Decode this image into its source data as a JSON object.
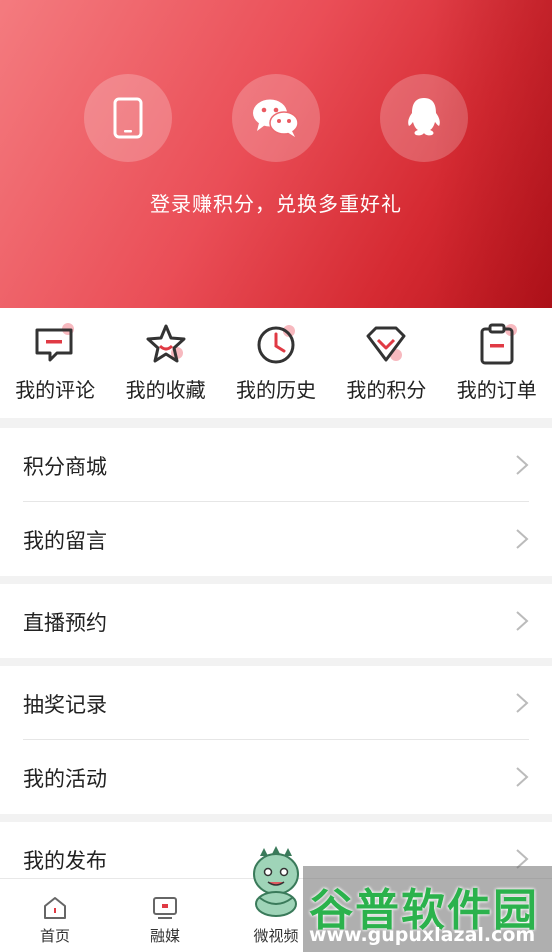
{
  "header": {
    "login_tip": "登录赚积分，兑换多重好礼",
    "login_options": [
      {
        "name": "phone",
        "icon": "phone-icon"
      },
      {
        "name": "wechat",
        "icon": "wechat-icon"
      },
      {
        "name": "qq",
        "icon": "qq-icon"
      }
    ]
  },
  "quick_entries": [
    {
      "label": "我的评论",
      "icon": "comment-icon"
    },
    {
      "label": "我的收藏",
      "icon": "star-icon"
    },
    {
      "label": "我的历史",
      "icon": "clock-icon"
    },
    {
      "label": "我的积分",
      "icon": "points-icon"
    },
    {
      "label": "我的订单",
      "icon": "clipboard-icon"
    }
  ],
  "menu": {
    "group1": [
      "积分商城",
      "我的留言"
    ],
    "group2": [
      "直播预约"
    ],
    "group3": [
      "抽奖记录",
      "我的活动"
    ],
    "group4": [
      "我的发布"
    ]
  },
  "tabbar": {
    "tabs": [
      {
        "label": "首页",
        "icon": "home-icon"
      },
      {
        "label": "融媒",
        "icon": "media-icon"
      },
      {
        "label": "微视频",
        "icon": "mascot-icon"
      }
    ]
  },
  "watermark": {
    "brand": "谷普软件园",
    "url": "www.gupuxlazal.com"
  },
  "colors": {
    "accent": "#e03a44",
    "icon_dark": "#333333",
    "icon_badge": "#f7b9bf"
  }
}
